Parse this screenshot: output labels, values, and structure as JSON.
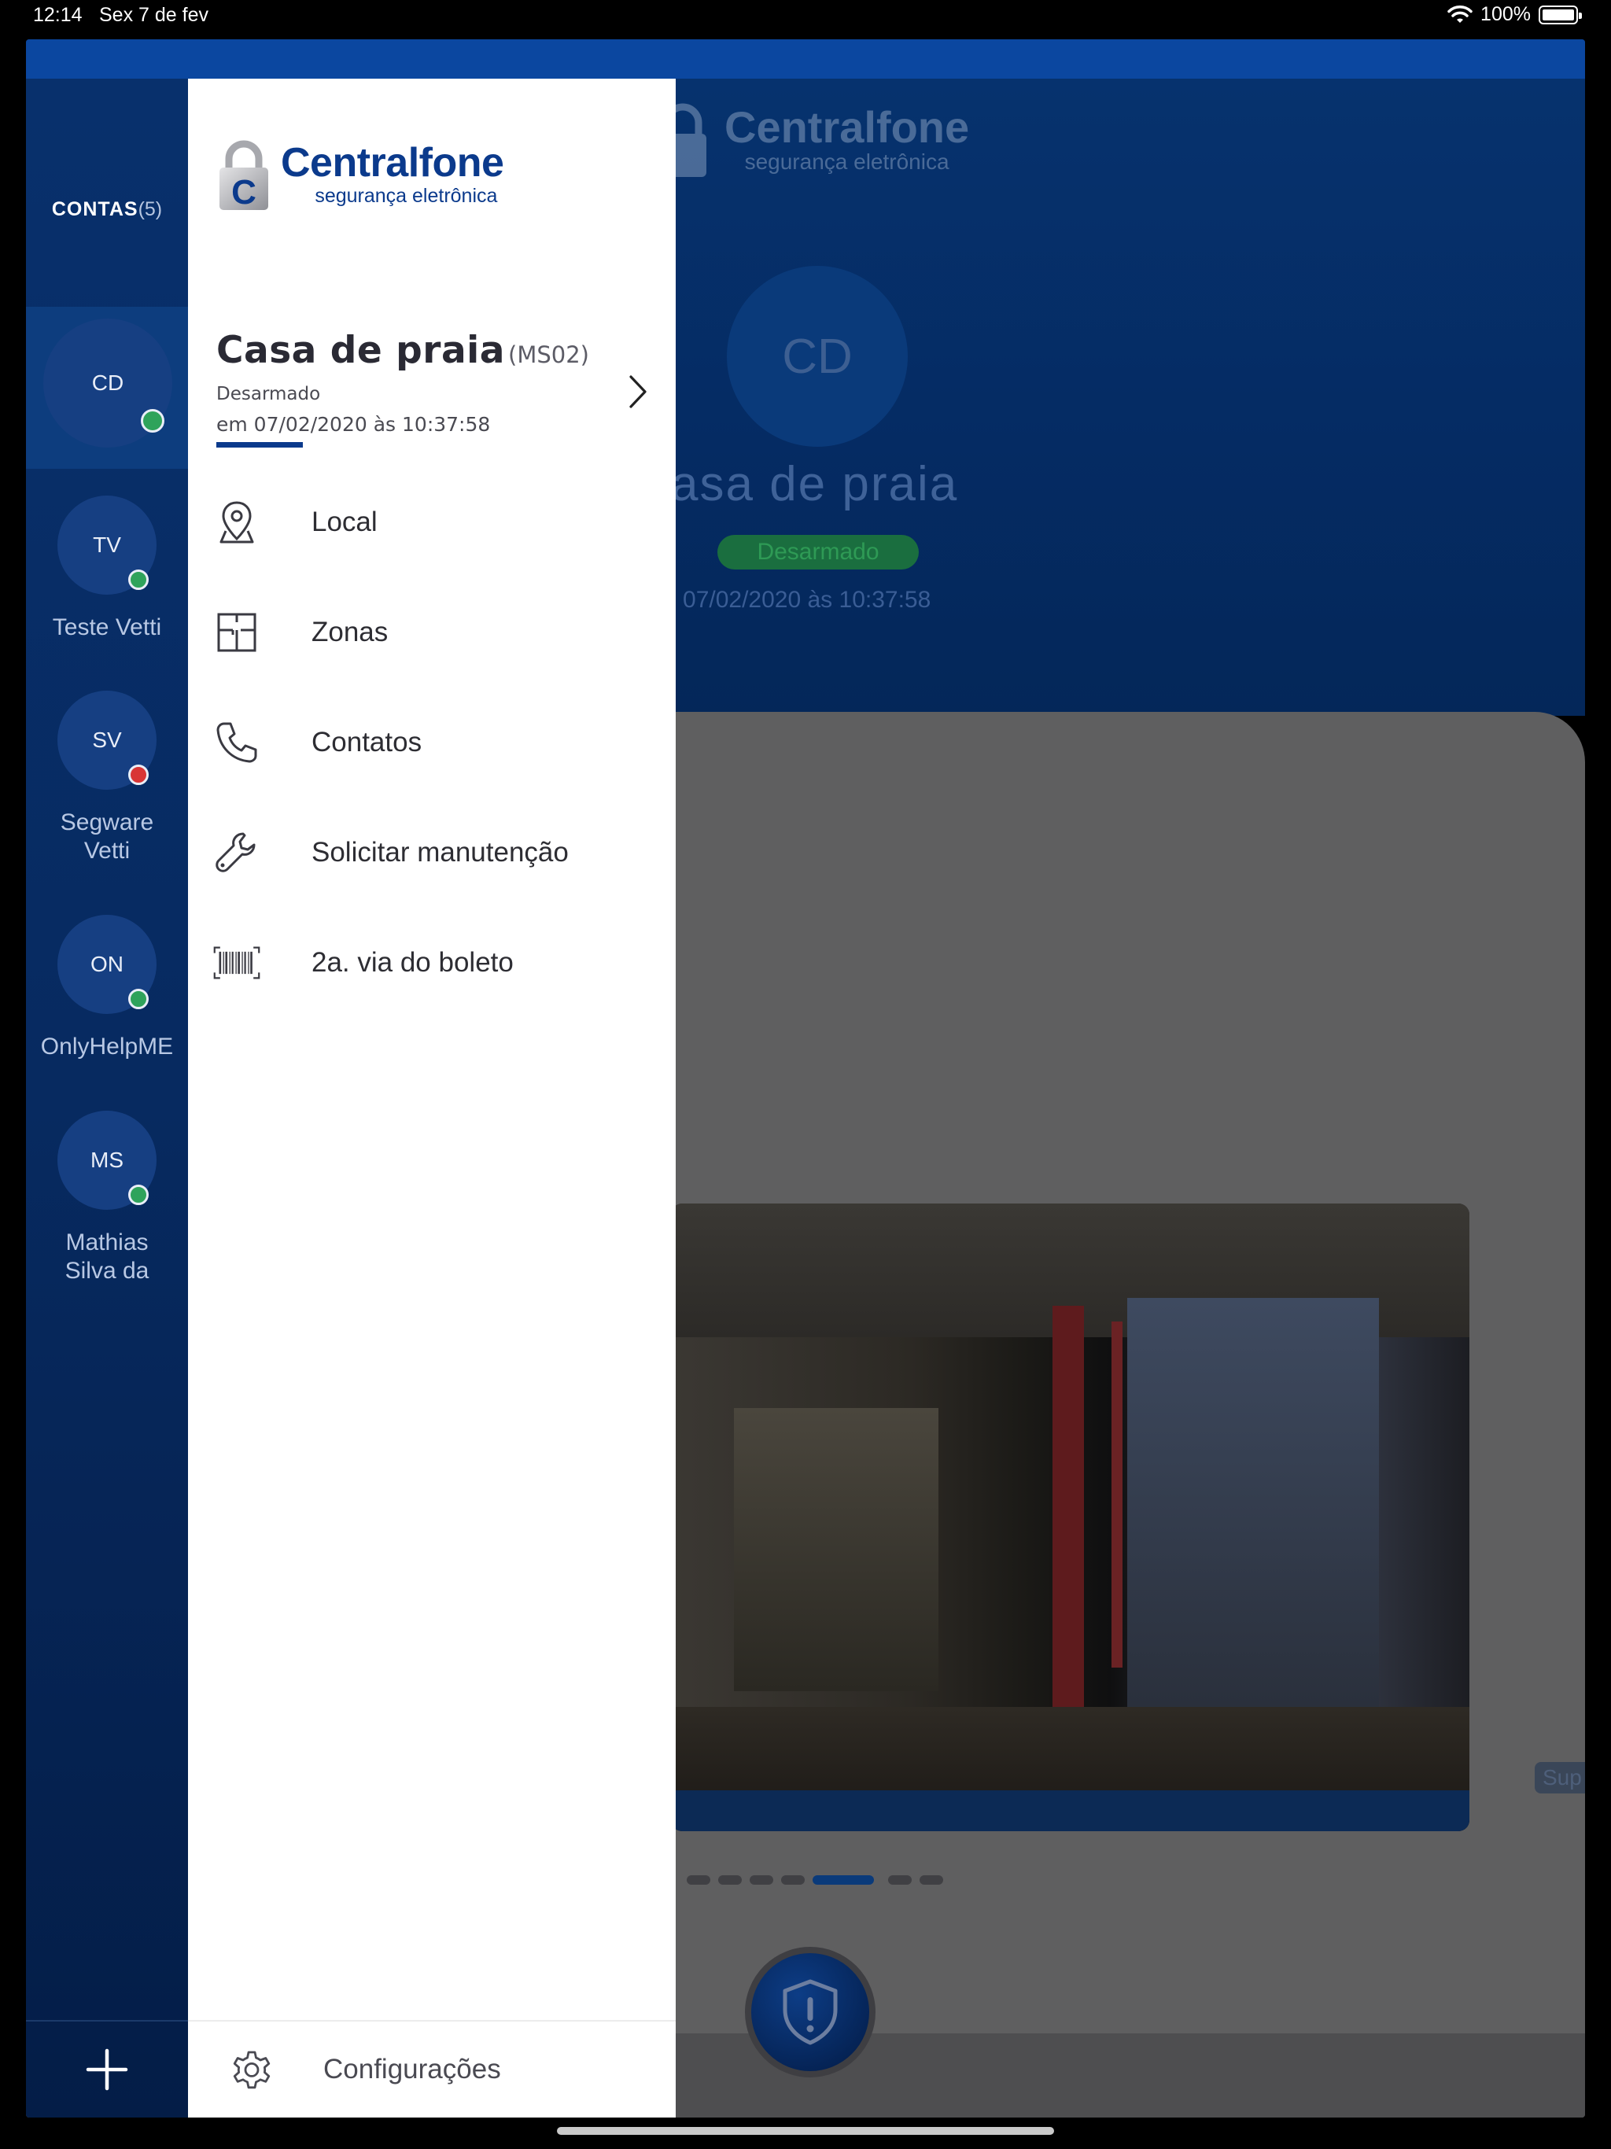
{
  "status_bar": {
    "time": "12:14",
    "date": "Sex 7 de fev",
    "battery": "100%"
  },
  "background_screen": {
    "logo_name": "Centralfone",
    "logo_sub": "segurança eletrônica",
    "avatar_initials": "CD",
    "title": "asa de praia",
    "badge": "Desarmado",
    "timestamp": "n 07/02/2020 às 10:37:58",
    "side_tab": "Sup",
    "carousel_active_index": 4,
    "carousel_total": 7
  },
  "accounts": {
    "label": "CONTAS",
    "count": "(5)",
    "items": [
      {
        "initials": "CD",
        "label": "",
        "status": "green",
        "selected": true
      },
      {
        "initials": "TV",
        "label": "Teste Vetti",
        "status": "green",
        "selected": false
      },
      {
        "initials": "SV",
        "label": "Segware Vetti",
        "status": "red",
        "selected": false
      },
      {
        "initials": "ON",
        "label": "OnlyHelpME",
        "status": "green",
        "selected": false
      },
      {
        "initials": "MS",
        "label": "Mathias Silva da",
        "status": "green",
        "selected": false
      }
    ]
  },
  "drawer": {
    "logo": {
      "name": "Centralfone",
      "sub": "segurança eletrônica"
    },
    "account": {
      "name": "Casa de praia",
      "code": "(MS02)",
      "status": "Desarmado",
      "timestamp": "em 07/02/2020 às 10:37:58"
    },
    "menu": [
      {
        "label": "Local",
        "icon": "map-pin-icon"
      },
      {
        "label": "Zonas",
        "icon": "floor-plan-icon"
      },
      {
        "label": "Contatos",
        "icon": "phone-icon"
      },
      {
        "label": "Solicitar manutenção",
        "icon": "wrench-icon"
      },
      {
        "label": "2a. via do boleto",
        "icon": "barcode-icon"
      }
    ],
    "settings_label": "Configurações"
  },
  "colors": {
    "brand_blue": "#0b3a8c",
    "status_green": "#2fa35b",
    "status_red": "#d83535"
  }
}
